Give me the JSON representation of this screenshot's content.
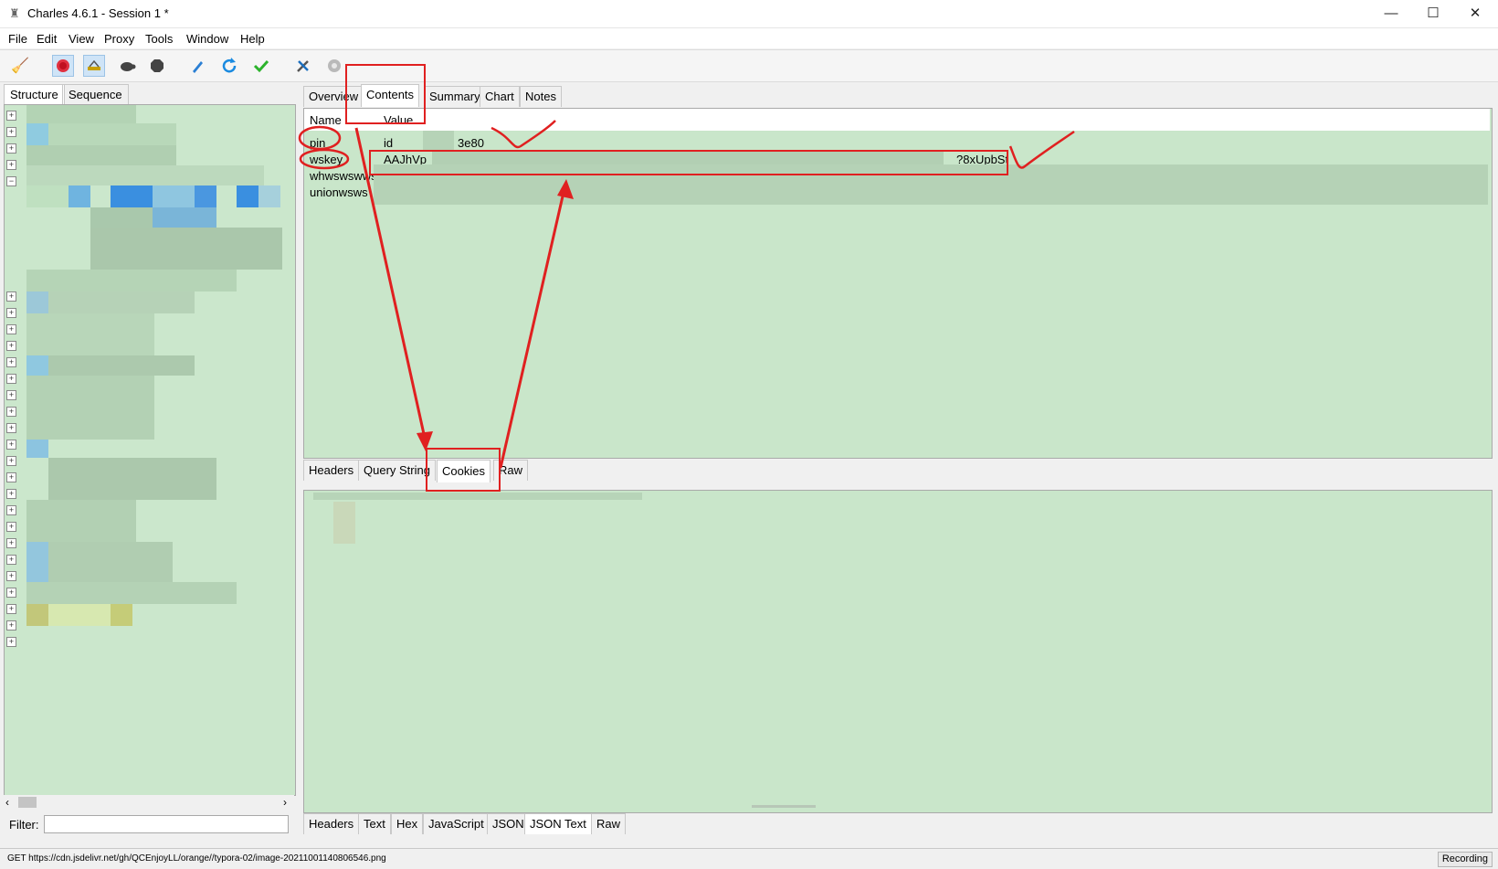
{
  "window": {
    "title": "Charles 4.6.1 - Session 1 *"
  },
  "menu": [
    "File",
    "Edit",
    "View",
    "Proxy",
    "Tools",
    "Window",
    "Help"
  ],
  "toolbar": {
    "icons": [
      "broom-icon",
      "record-icon",
      "throttle-icon",
      "turtle-icon",
      "stop-icon",
      "pen-icon",
      "refresh-icon",
      "check-icon",
      "tools-icon",
      "settings-icon"
    ]
  },
  "left_tabs": [
    "Structure",
    "Sequence"
  ],
  "filter": {
    "label": "Filter:",
    "value": ""
  },
  "upper_tabs": [
    "Overview",
    "Contents",
    "Summary",
    "Chart",
    "Notes"
  ],
  "cookies_table": {
    "columns": [
      "Name",
      "Value"
    ],
    "rows": [
      {
        "name": "pin",
        "value_start": "id",
        "value_end": "3e80"
      },
      {
        "name": "wskey",
        "value_start": "AAJhVp",
        "value_end": "?8xUpbSt"
      },
      {
        "name": "whwswswws",
        "value_start": "",
        "value_end": ""
      },
      {
        "name": "unionwsws",
        "value_start": "",
        "value_end": ""
      }
    ]
  },
  "request_tabs": [
    "Headers",
    "Query String",
    "Cookies",
    "Raw"
  ],
  "response_tabs": [
    "Headers",
    "Text",
    "Hex",
    "JavaScript",
    "JSON",
    "JSON Text",
    "Raw"
  ],
  "status": {
    "text": "GET https://cdn.jsdelivr.net/gh/QCEnjoyLL/orange//typora-02/image-20211001140806546.png",
    "recording": "Recording"
  },
  "colors": {
    "annotation": "#e02020",
    "highlight": "#c9e6ca"
  }
}
